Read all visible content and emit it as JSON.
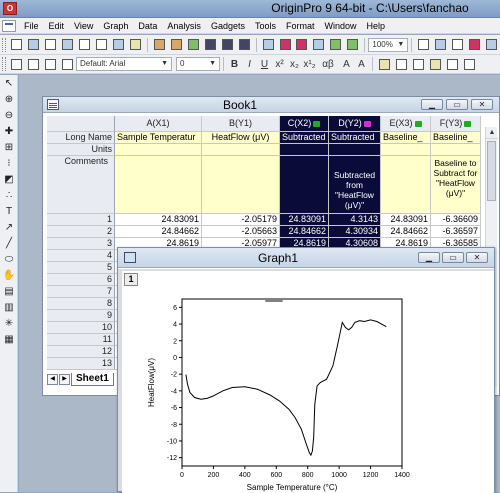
{
  "app": {
    "title": "OriginPro 9 64-bit - C:\\Users\\fanchao"
  },
  "menu": [
    "File",
    "Edit",
    "View",
    "Graph",
    "Data",
    "Analysis",
    "Gadgets",
    "Tools",
    "Format",
    "Window",
    "Help"
  ],
  "toolbar": {
    "zoom": "100%",
    "font": "Default: Arial",
    "font_size": "0"
  },
  "book1": {
    "title": "Book1",
    "row_headers": {
      "long_name": "Long Name",
      "units": "Units",
      "comments": "Comments"
    },
    "columns": [
      {
        "name": "A(X1)",
        "long_name": "Sample Temperatur",
        "units": "",
        "comments": ""
      },
      {
        "name": "B(Y1)",
        "long_name": "HeatFlow (μV)",
        "units": "",
        "comments": ""
      },
      {
        "name": "C(X2)",
        "long_name": "Subtracted",
        "units": "",
        "comments": ""
      },
      {
        "name": "D(Y2)",
        "long_name": "Subtracted",
        "units": "",
        "comments": "Subtracted from \"HeatFlow (μV)\""
      },
      {
        "name": "E(X3)",
        "long_name": "Baseline_",
        "units": "",
        "comments": ""
      },
      {
        "name": "F(Y3)",
        "long_name": "Baseline_",
        "units": "",
        "comments": "Baseline to Subtract for \"HeatFlow (μV)\""
      }
    ],
    "rows": [
      {
        "n": "1",
        "v": [
          "24.83091",
          "-2.05179",
          "24.83091",
          "4.3143",
          "24.83091",
          "-6.36609"
        ]
      },
      {
        "n": "2",
        "v": [
          "24.84662",
          "-2.05663",
          "24.84662",
          "4.30934",
          "24.84662",
          "-6.36597"
        ]
      },
      {
        "n": "3",
        "v": [
          "24.8619",
          "-2.05977",
          "24.8619",
          "4.30608",
          "24.8619",
          "-6.36585"
        ]
      },
      {
        "n": "4",
        "v": [
          "",
          "",
          "",
          "",
          "",
          ""
        ]
      },
      {
        "n": "5",
        "v": [
          "",
          "",
          "",
          "",
          "",
          ""
        ]
      },
      {
        "n": "6",
        "v": [
          "",
          "",
          "",
          "",
          "",
          ""
        ]
      },
      {
        "n": "7",
        "v": [
          "",
          "",
          "",
          "",
          "",
          ""
        ]
      },
      {
        "n": "8",
        "v": [
          "",
          "",
          "",
          "",
          "",
          ""
        ]
      },
      {
        "n": "9",
        "v": [
          "",
          "",
          "",
          "",
          "",
          ""
        ]
      },
      {
        "n": "10",
        "v": [
          "",
          "",
          "",
          "",
          "",
          ""
        ]
      },
      {
        "n": "11",
        "v": [
          "",
          "",
          "",
          "",
          "",
          ""
        ]
      },
      {
        "n": "12",
        "v": [
          "",
          "",
          "",
          "",
          "",
          ""
        ]
      },
      {
        "n": "13",
        "v": [
          "",
          "",
          "",
          "",
          "",
          ""
        ]
      }
    ],
    "sheet_tab": "Sheet1"
  },
  "graph1": {
    "title": "Graph1",
    "layer": "1",
    "chart_data": {
      "type": "line",
      "xlabel": "Sample Temperature (°C)",
      "ylabel": "HeatFlow(μV)",
      "xlim": [
        0,
        1400
      ],
      "ylim": [
        -13,
        7
      ],
      "xticks": [
        "0",
        "200",
        "400",
        "600",
        "800",
        "1000",
        "1200",
        "1400"
      ],
      "yticks": [
        "6",
        "4",
        "2",
        "0",
        "-2",
        "-4",
        "-6",
        "-8",
        "-10",
        "-12"
      ],
      "series": [
        {
          "x": [
            25,
            35,
            50,
            80,
            120,
            160,
            200,
            260,
            320,
            400,
            480,
            560,
            620,
            680,
            720,
            760,
            790,
            810,
            820,
            830,
            838,
            845,
            860,
            880,
            920,
            960,
            990,
            1020,
            1040,
            1060,
            1080,
            1100,
            1130,
            1160,
            1200,
            1240,
            1280,
            1300
          ],
          "y": [
            -2.05,
            -3.2,
            -4.2,
            -4.8,
            -5.0,
            -4.9,
            -4.6,
            -4.0,
            -3.6,
            -3.5,
            -3.8,
            -4.5,
            -5.2,
            -6.2,
            -7.2,
            -8.6,
            -10.3,
            -11.4,
            -11.7,
            -11.2,
            -9.5,
            -5.6,
            -3.4,
            -3.0,
            -2.6,
            -1.0,
            1.5,
            4.2,
            3.6,
            3.3,
            3.6,
            4.2,
            4.4,
            4.3,
            4.5,
            4.3,
            3.9,
            3.7
          ]
        }
      ],
      "legend_mark": true
    }
  }
}
